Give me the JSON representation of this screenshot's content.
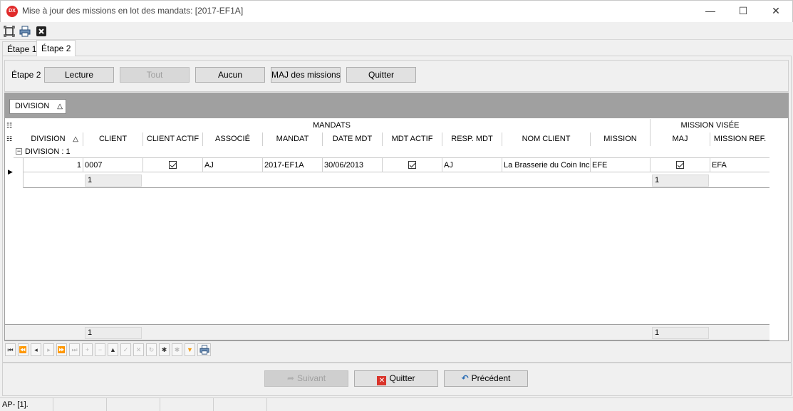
{
  "window": {
    "title": "Mise à jour des missions en lot des mandats: [2017-EF1A]",
    "app_icon_text": "DX",
    "minimize": "—",
    "maximize": "☐",
    "close": "✕"
  },
  "tabs": [
    {
      "label": "Étape 1"
    },
    {
      "label": "Étape 2"
    }
  ],
  "step": {
    "label": "Étape 2",
    "buttons": {
      "lecture": "Lecture",
      "tout": "Tout",
      "aucun": "Aucun",
      "maj": "MAJ des missions",
      "quitter": "Quitter"
    }
  },
  "grid": {
    "group_chip": "DIVISION",
    "band_mandats": "MANDATS",
    "band_mission": "MISSION VISÉE",
    "columns": {
      "division": "DIVISION",
      "client": "CLIENT",
      "client_actif": "CLIENT ACTIF",
      "associe": "ASSOCIÉ",
      "mandat": "MANDAT",
      "date_mdt": "DATE MDT",
      "mdt_actif": "MDT ACTIF",
      "resp_mdt": "RESP.  MDT",
      "nom_client": "NOM CLIENT",
      "mission": "MISSION",
      "maj": "MAJ",
      "mission_ref": "MISSION REF."
    },
    "group_row": "DIVISION : 1",
    "row": {
      "division": "1",
      "client": "0007",
      "associe": "AJ",
      "mandat": "2017-EF1A",
      "date_mdt": "30/06/2013",
      "resp_mdt": "AJ",
      "nom_client": "La Brasserie du Coin Inc.",
      "mission": "EFE",
      "mission_ref": "EFA"
    },
    "group_summary": {
      "client": "1",
      "maj": "1"
    },
    "footer": {
      "client": "1",
      "maj": "1"
    }
  },
  "bottom": {
    "suivant": "Suivant",
    "quitter": "Quitter",
    "precedent": "Précédent"
  },
  "status": {
    "left": "AP- [1]."
  },
  "colors": {
    "accent_red": "#d9342b",
    "accent_blue": "#2a6db5",
    "filter_orange": "#f39c12"
  }
}
